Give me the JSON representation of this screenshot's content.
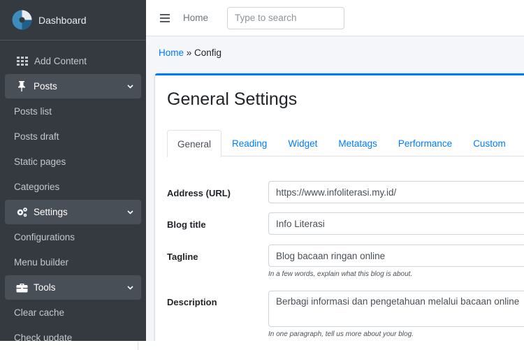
{
  "sidebar": {
    "brand": "Dashboard",
    "items": [
      {
        "label": "Add Content",
        "icon": "grid-icon"
      },
      {
        "label": "Posts",
        "icon": "pin-icon"
      },
      {
        "label": "Posts list"
      },
      {
        "label": "Posts draft"
      },
      {
        "label": "Static pages"
      },
      {
        "label": "Categories"
      },
      {
        "label": "Settings",
        "icon": "cogs-icon"
      },
      {
        "label": "Configurations"
      },
      {
        "label": "Menu builder"
      },
      {
        "label": "Tools",
        "icon": "toolbox-icon"
      },
      {
        "label": "Clear cache"
      },
      {
        "label": "Check update"
      }
    ]
  },
  "topbar": {
    "home": "Home",
    "search_placeholder": "Type to search"
  },
  "breadcrumb": {
    "home": "Home",
    "separator": " » ",
    "current": "Config"
  },
  "card": {
    "title": "General Settings",
    "tabs": [
      "General",
      "Reading",
      "Widget",
      "Metatags",
      "Performance",
      "Custom"
    ],
    "active_tab": "General"
  },
  "form": {
    "address": {
      "label": "Address (URL)",
      "value": "https://www.infoliterasi.my.id/"
    },
    "blog_title": {
      "label": "Blog title",
      "value": "Info Literasi"
    },
    "tagline": {
      "label": "Tagline",
      "value": "Blog bacaan ringan online",
      "help": "In a few words, explain what this blog is about."
    },
    "description": {
      "label": "Description",
      "value": "Berbagi informasi dan pengetahuan melalui bacaan online",
      "help": "In one paragraph, tell us more about your blog."
    }
  },
  "colors": {
    "sidebar": "#343a40",
    "accent": "#007bff",
    "content_bg": "#f4f6f9"
  }
}
